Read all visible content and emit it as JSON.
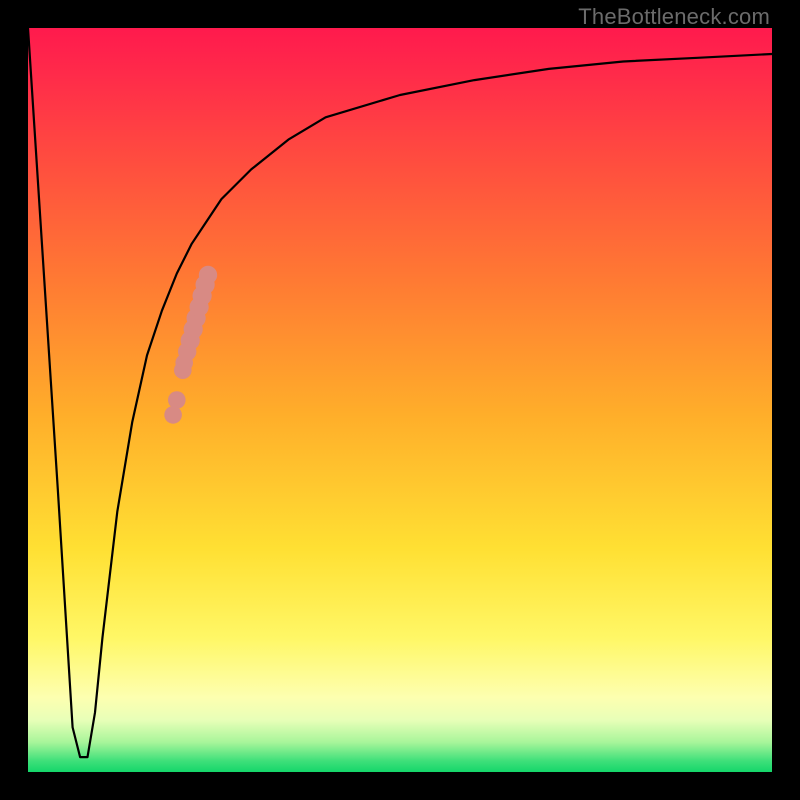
{
  "watermark": "TheBottleneck.com",
  "colors": {
    "curve": "#000000",
    "markers": "#d88a84",
    "frame": "#000000"
  },
  "chart_data": {
    "type": "line",
    "title": "",
    "xlabel": "",
    "ylabel": "",
    "xlim": [
      0,
      100
    ],
    "ylim": [
      0,
      100
    ],
    "series": [
      {
        "name": "bottleneck-curve",
        "x": [
          0,
          4,
          6,
          7,
          8,
          9,
          10,
          12,
          14,
          16,
          18,
          20,
          22,
          24,
          26,
          30,
          35,
          40,
          50,
          60,
          70,
          80,
          90,
          100
        ],
        "y": [
          100,
          38,
          6,
          2,
          2,
          8,
          18,
          35,
          47,
          56,
          62,
          67,
          71,
          74,
          77,
          81,
          85,
          88,
          91,
          93,
          94.5,
          95.5,
          96,
          96.5
        ]
      }
    ],
    "markers": [
      {
        "name": "highlight-dots",
        "x": 19.5,
        "y": 48,
        "r": 1.3
      },
      {
        "name": "highlight-dots",
        "x": 20.0,
        "y": 50,
        "r": 1.3
      },
      {
        "name": "highlight-dots",
        "x": 20.8,
        "y": 54,
        "r": 1.3
      },
      {
        "name": "highlight-dots",
        "x": 21.0,
        "y": 55,
        "r": 1.3
      },
      {
        "name": "highlight-dots",
        "x": 21.4,
        "y": 56.5,
        "r": 1.4
      },
      {
        "name": "highlight-dots",
        "x": 21.8,
        "y": 58,
        "r": 1.5
      },
      {
        "name": "highlight-dots",
        "x": 22.2,
        "y": 59.5,
        "r": 1.5
      },
      {
        "name": "highlight-dots",
        "x": 22.6,
        "y": 61,
        "r": 1.5
      },
      {
        "name": "highlight-dots",
        "x": 23.0,
        "y": 62.5,
        "r": 1.5
      },
      {
        "name": "highlight-dots",
        "x": 23.4,
        "y": 64,
        "r": 1.5
      },
      {
        "name": "highlight-dots",
        "x": 23.8,
        "y": 65.5,
        "r": 1.5
      },
      {
        "name": "highlight-dots",
        "x": 24.2,
        "y": 66.8,
        "r": 1.4
      }
    ]
  }
}
